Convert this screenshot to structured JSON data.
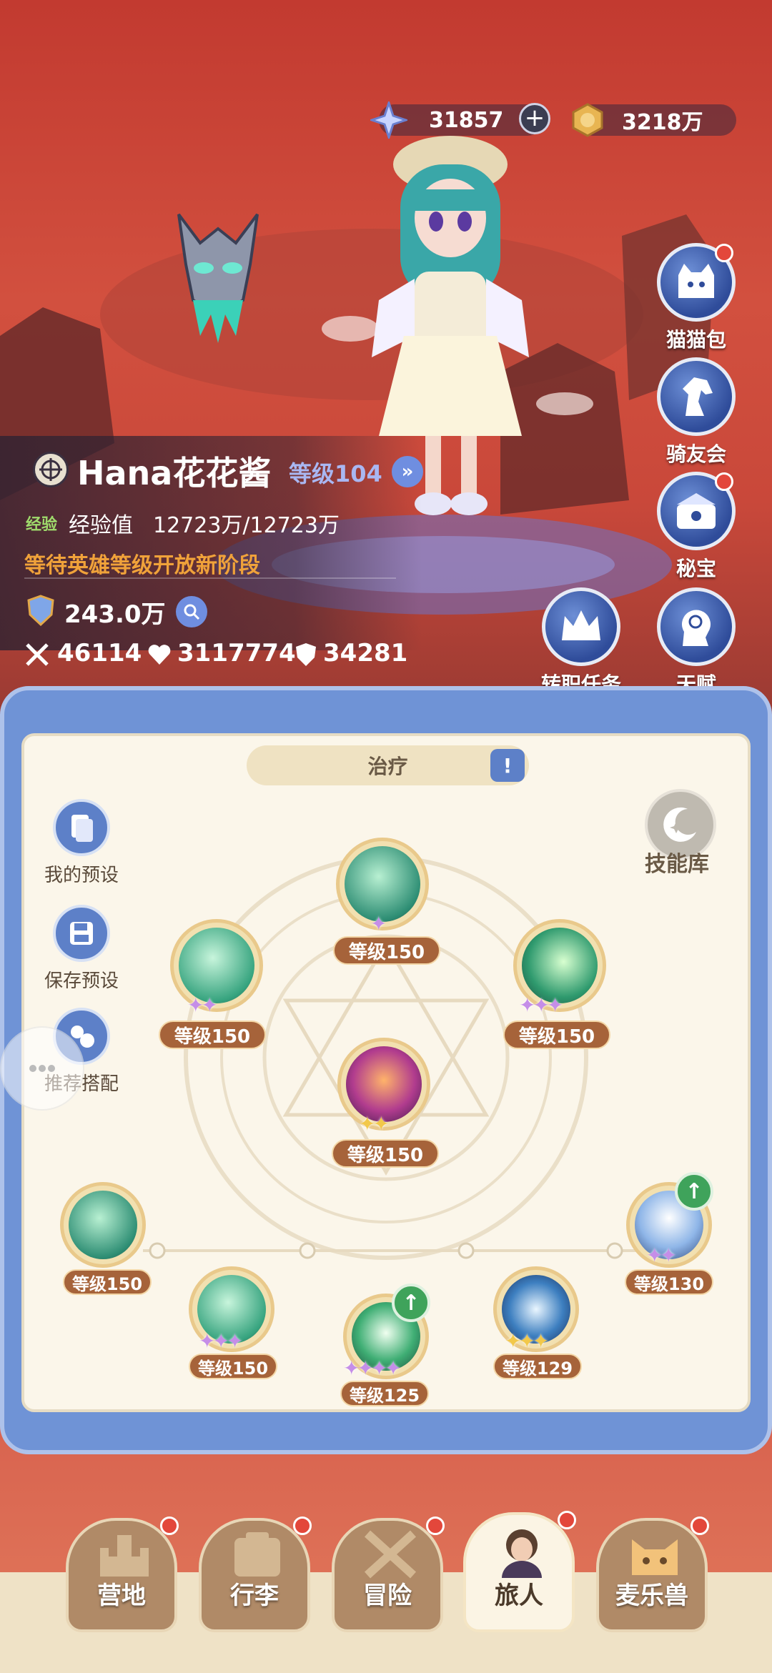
{
  "currency": {
    "gems": "31857",
    "gold": "3218万"
  },
  "icons": {
    "gem": "star-crystal-icon",
    "gold": "coin-icon",
    "add": "plus-icon"
  },
  "side_menu": [
    {
      "label": "猫猫包",
      "icon": "cat-bag-icon",
      "badge": true
    },
    {
      "label": "骑友会",
      "icon": "horse-icon",
      "badge": false
    },
    {
      "label": "秘宝",
      "icon": "treasure-box-icon",
      "badge": true
    },
    {
      "label": "转职任务",
      "icon": "crown-icon",
      "badge": false
    },
    {
      "label": "天赋",
      "icon": "brain-head-icon",
      "badge": false
    }
  ],
  "player": {
    "name": "Hana花花酱",
    "level_label": "等级104",
    "exp_tag": "经验",
    "exp_label": "经验值",
    "exp_value": "12723万/12723万",
    "notice": "等待英雄等级开放新阶段",
    "power": "243.0万",
    "attack": "46114",
    "hp": "3117774",
    "defense": "34281"
  },
  "panel": {
    "tab_label": "治疗",
    "skill_library": "技能库",
    "my_preset": "我的预设",
    "save_preset": "保存预设",
    "recommend": "推荐搭配"
  },
  "skills": [
    {
      "level": "等级150",
      "stars": "✦",
      "star_color": "purple",
      "upgrade": false
    },
    {
      "level": "等级150",
      "stars": "✦✦",
      "star_color": "purple",
      "upgrade": false
    },
    {
      "level": "等级150",
      "stars": "✦✦✦",
      "star_color": "purple",
      "upgrade": false
    },
    {
      "level": "等级150",
      "stars": "✦✦",
      "star_color": "gold",
      "upgrade": false
    },
    {
      "level": "等级150",
      "stars": "✦✦",
      "star_color": "purple",
      "upgrade": false
    },
    {
      "level": "等级150",
      "stars": "✦✦✦",
      "star_color": "purple",
      "upgrade": false
    },
    {
      "level": "等级125",
      "stars": "✦✦✦✦",
      "star_color": "purple",
      "upgrade": true
    },
    {
      "level": "等级129",
      "stars": "✦✦✦",
      "star_color": "gold",
      "upgrade": false
    },
    {
      "level": "等级130",
      "stars": "✦✦",
      "star_color": "purple",
      "upgrade": true
    }
  ],
  "bottom_nav": [
    {
      "label": "营地",
      "badge": true,
      "active": false
    },
    {
      "label": "行李",
      "badge": true,
      "active": false
    },
    {
      "label": "冒险",
      "badge": true,
      "active": false
    },
    {
      "label": "旅人",
      "badge": true,
      "active": true
    },
    {
      "label": "麦乐兽",
      "badge": true,
      "active": false
    }
  ]
}
